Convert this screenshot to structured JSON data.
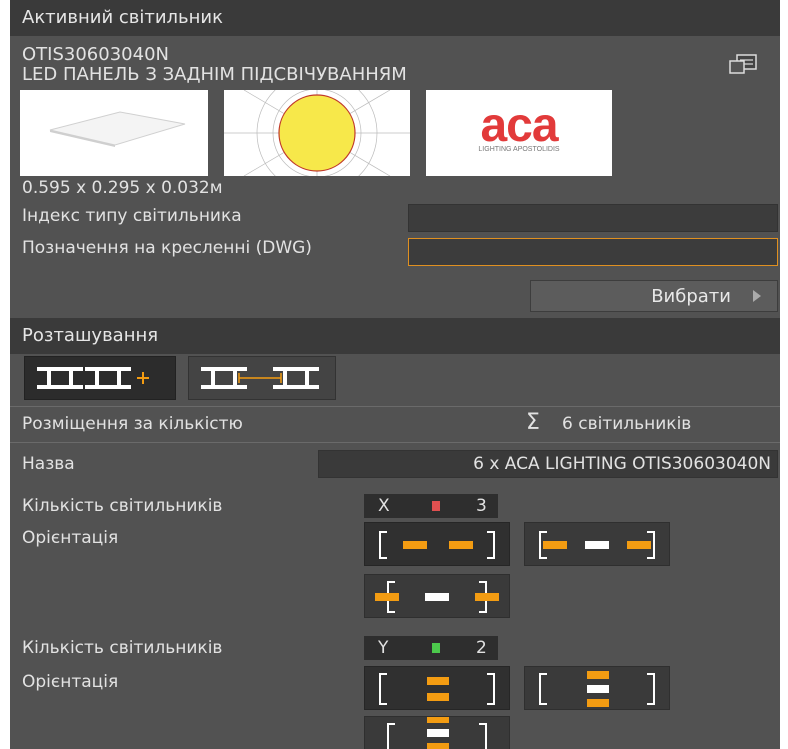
{
  "active_section": {
    "title": "Активний світильник",
    "product_code": "OTIS30603040N",
    "product_name": "LED ПАНЕЛЬ З ЗАДНІМ ПІДСВІЧУВАННЯМ",
    "dimensions": "0.595 x 0.295 x 0.032м",
    "logo_text": "aca",
    "logo_subtext": "LIGHTING APOSTOLIDIS",
    "type_index_label": "Індекс типу світильника",
    "type_index_value": "",
    "dwg_label": "Позначення на кресленні (DWG)",
    "dwg_value": "",
    "select_button": "Вибрати",
    "accent_color": "#f39c12"
  },
  "placement_section": {
    "title": "Розташування",
    "mode_label": "Розміщення за кількістю",
    "sum_symbol": "Σ",
    "total": "6 світильників",
    "name_label": "Назва",
    "name_value": "6 x ACA LIGHTING OTIS30603040N",
    "count_label_x": "Кількість світильників",
    "axis_x": "X",
    "count_x": "3",
    "orientation_label_x": "Орієнтація",
    "count_label_y": "Кількість світильників",
    "axis_y": "Y",
    "count_y": "2",
    "orientation_label_y": "Орієнтація",
    "x_indicator_color": "#e05050",
    "y_indicator_color": "#4cc94c"
  }
}
